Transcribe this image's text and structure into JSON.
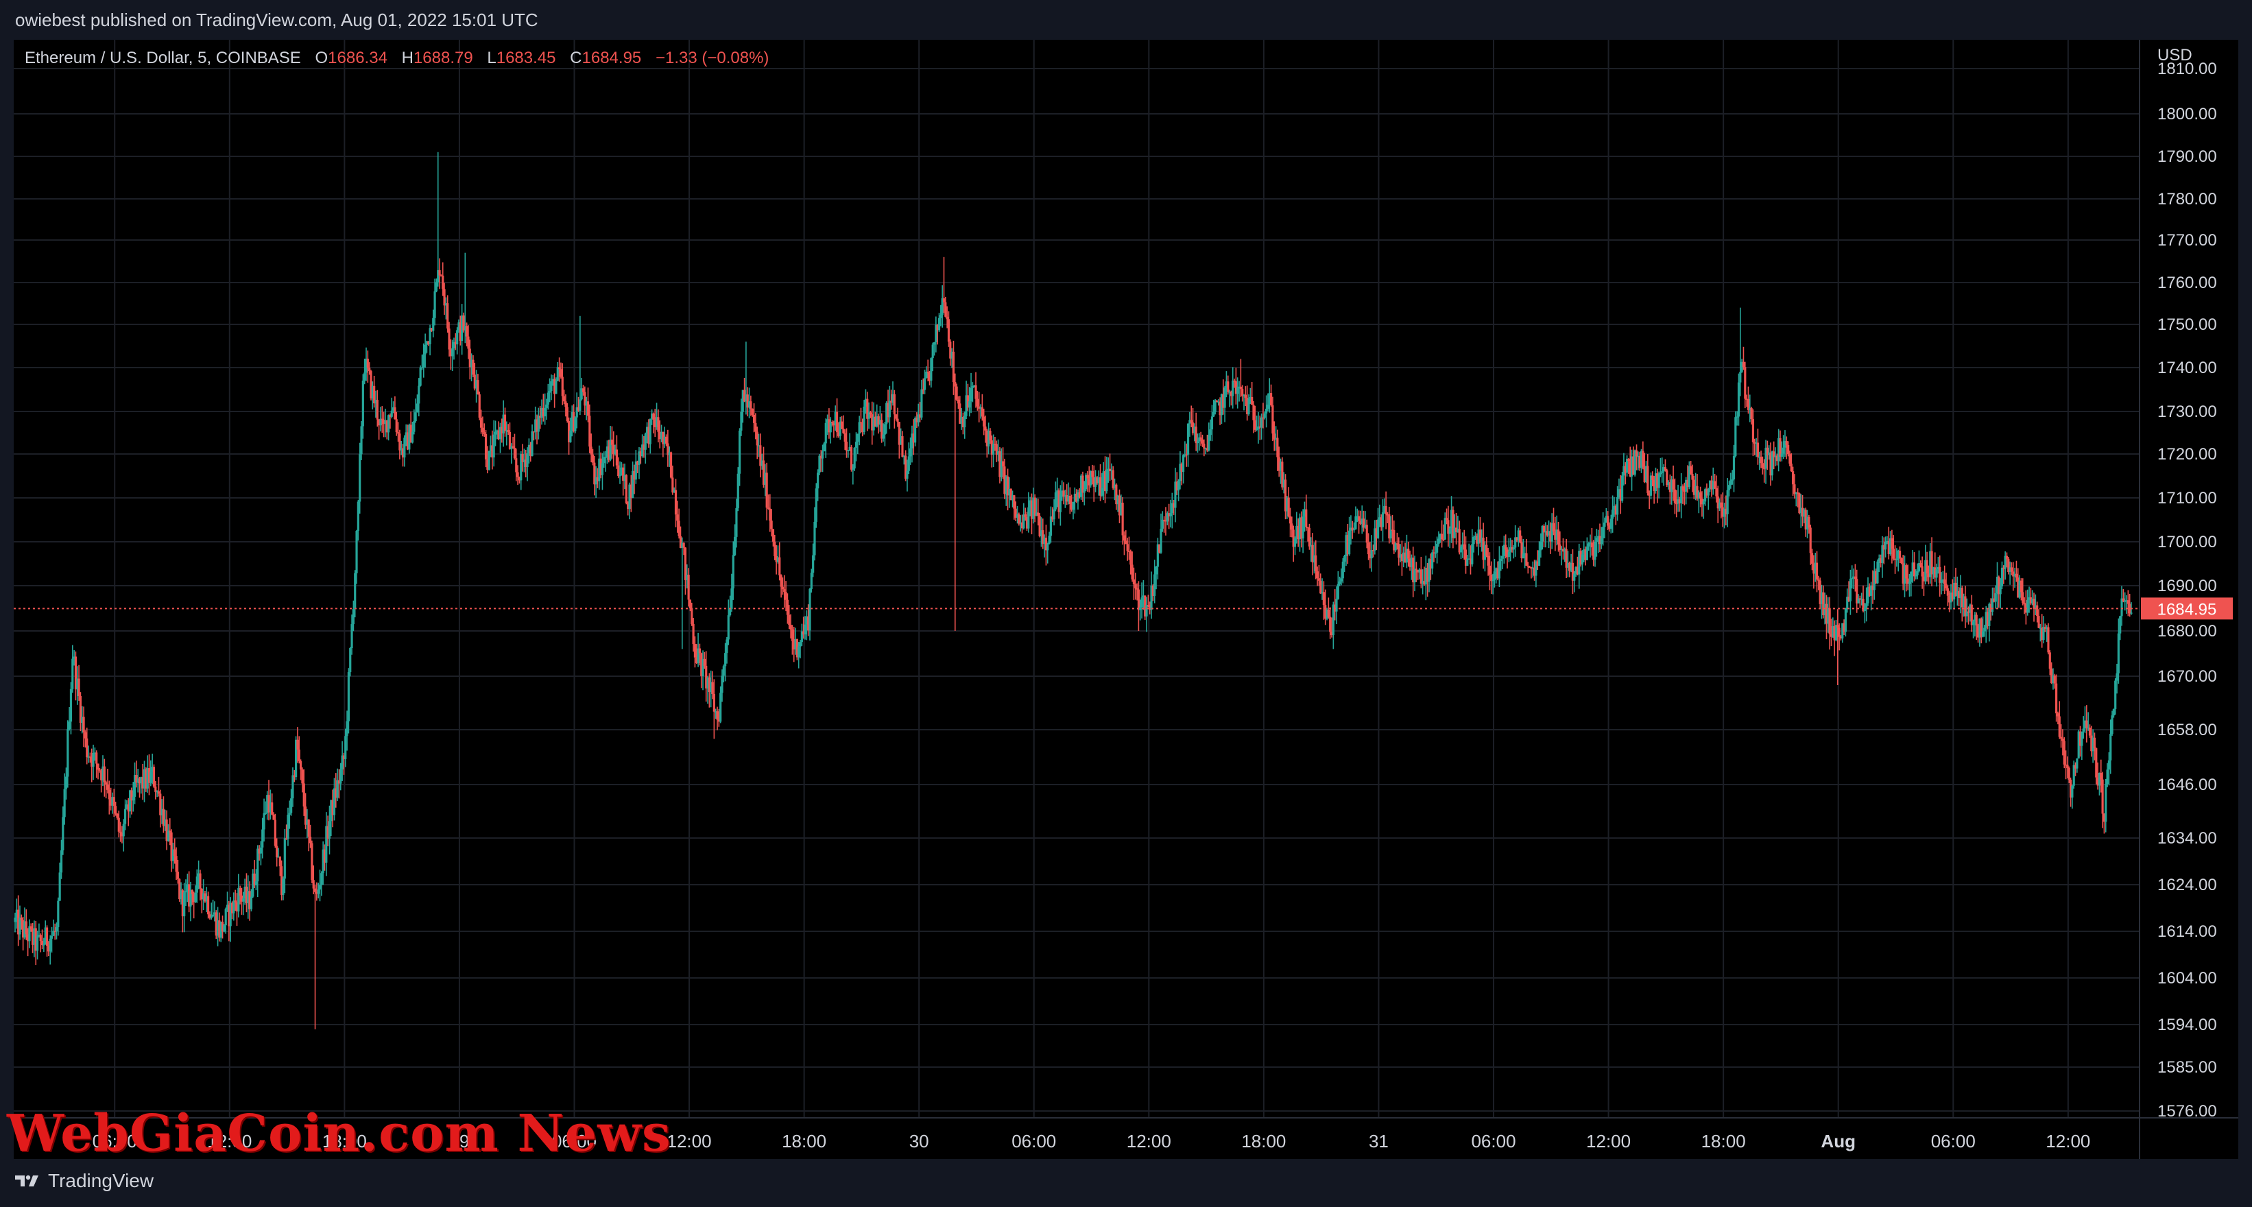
{
  "header": {
    "published_by": "owiebest published on TradingView.com, Aug 01, 2022 15:01 UTC"
  },
  "footer": {
    "brand": "TradingView",
    "logo_icon": "tradingview-logo-icon"
  },
  "watermark": "WebGiaCoin.com News",
  "legend": {
    "symbol": "Ethereum / U.S. Dollar, 5, COINBASE",
    "o_label": "O",
    "o_value": "1686.34",
    "h_label": "H",
    "h_value": "1688.79",
    "l_label": "L",
    "l_value": "1683.45",
    "c_label": "C",
    "c_value": "1684.95",
    "change": "−1.33 (−0.08%)"
  },
  "colors": {
    "background": "#000000",
    "up": "#26a69a",
    "down": "#ef5350",
    "grid": "#1c1f26",
    "price_label_bg": "#ef5350"
  },
  "chart_data": {
    "type": "candlestick",
    "currency": "USD",
    "current_price": 1684.95,
    "current_price_label": "1684.95",
    "y_ticks": [
      {
        "label": "1810.00",
        "value": 1810
      },
      {
        "label": "1800.00",
        "value": 1800
      },
      {
        "label": "1790.00",
        "value": 1790
      },
      {
        "label": "1780.00",
        "value": 1780
      },
      {
        "label": "1770.00",
        "value": 1770
      },
      {
        "label": "1760.00",
        "value": 1760
      },
      {
        "label": "1750.00",
        "value": 1750
      },
      {
        "label": "1740.00",
        "value": 1740
      },
      {
        "label": "1730.00",
        "value": 1730
      },
      {
        "label": "1720.00",
        "value": 1720
      },
      {
        "label": "1710.00",
        "value": 1710
      },
      {
        "label": "1700.00",
        "value": 1700
      },
      {
        "label": "1690.00",
        "value": 1690
      },
      {
        "label": "1680.00",
        "value": 1680
      },
      {
        "label": "1670.00",
        "value": 1670
      },
      {
        "label": "1658.00",
        "value": 1658
      },
      {
        "label": "1646.00",
        "value": 1646
      },
      {
        "label": "1634.00",
        "value": 1634
      },
      {
        "label": "1624.00",
        "value": 1624
      },
      {
        "label": "1614.00",
        "value": 1614
      },
      {
        "label": "1604.00",
        "value": 1604
      },
      {
        "label": "1594.00",
        "value": 1594
      },
      {
        "label": "1585.00",
        "value": 1585
      },
      {
        "label": "1576.00",
        "value": 1576
      }
    ],
    "x_ticks": [
      {
        "label": "06:00",
        "hour": 6
      },
      {
        "label": "12:00",
        "hour": 12
      },
      {
        "label": "18:00",
        "hour": 18
      },
      {
        "label": "29",
        "hour": 24,
        "bold": false
      },
      {
        "label": "06:00",
        "hour": 30
      },
      {
        "label": "12:00",
        "hour": 36
      },
      {
        "label": "18:00",
        "hour": 42
      },
      {
        "label": "30",
        "hour": 48,
        "bold": false
      },
      {
        "label": "06:00",
        "hour": 54
      },
      {
        "label": "12:00",
        "hour": 60
      },
      {
        "label": "18:00",
        "hour": 66
      },
      {
        "label": "31",
        "hour": 72,
        "bold": false
      },
      {
        "label": "06:00",
        "hour": 78
      },
      {
        "label": "12:00",
        "hour": 84
      },
      {
        "label": "18:00",
        "hour": 90
      },
      {
        "label": "Aug",
        "hour": 96,
        "bold": true
      },
      {
        "label": "06:00",
        "hour": 102
      },
      {
        "label": "12:00",
        "hour": 108
      }
    ],
    "x_range_hours": [
      0.8,
      111.3
    ],
    "y_range": [
      1573,
      1810
    ],
    "price_path": [
      [
        0.8,
        1616
      ],
      [
        2.0,
        1611
      ],
      [
        3.0,
        1614
      ],
      [
        3.8,
        1675
      ],
      [
        4.5,
        1654
      ],
      [
        5.5,
        1648
      ],
      [
        6.3,
        1634
      ],
      [
        7.0,
        1645
      ],
      [
        8.0,
        1648
      ],
      [
        8.5,
        1640
      ],
      [
        9.5,
        1620
      ],
      [
        10.5,
        1624
      ],
      [
        11.5,
        1614
      ],
      [
        12.5,
        1622
      ],
      [
        13.0,
        1620
      ],
      [
        13.5,
        1630
      ],
      [
        14.0,
        1644
      ],
      [
        14.7,
        1624
      ],
      [
        15.5,
        1655
      ],
      [
        16.5,
        1620
      ],
      [
        17.3,
        1640
      ],
      [
        18.0,
        1652
      ],
      [
        18.7,
        1705
      ],
      [
        19.0,
        1742
      ],
      [
        20.0,
        1725
      ],
      [
        20.5,
        1732
      ],
      [
        21.0,
        1720
      ],
      [
        21.7,
        1728
      ],
      [
        22.0,
        1740
      ],
      [
        22.5,
        1750
      ],
      [
        23.0,
        1765
      ],
      [
        23.5,
        1745
      ],
      [
        24.2,
        1750
      ],
      [
        24.8,
        1738
      ],
      [
        25.5,
        1718
      ],
      [
        26.3,
        1728
      ],
      [
        27.0,
        1715
      ],
      [
        27.7,
        1722
      ],
      [
        28.5,
        1733
      ],
      [
        29.2,
        1738
      ],
      [
        29.7,
        1725
      ],
      [
        30.5,
        1735
      ],
      [
        31.0,
        1715
      ],
      [
        32.0,
        1722
      ],
      [
        32.8,
        1710
      ],
      [
        33.5,
        1722
      ],
      [
        34.2,
        1728
      ],
      [
        35.0,
        1718
      ],
      [
        35.6,
        1700
      ],
      [
        36.3,
        1676
      ],
      [
        37.0,
        1668
      ],
      [
        37.5,
        1660
      ],
      [
        38.2,
        1690
      ],
      [
        38.8,
        1735
      ],
      [
        39.3,
        1728
      ],
      [
        40.0,
        1712
      ],
      [
        40.8,
        1690
      ],
      [
        41.5,
        1676
      ],
      [
        42.2,
        1682
      ],
      [
        42.8,
        1720
      ],
      [
        43.5,
        1730
      ],
      [
        44.5,
        1718
      ],
      [
        45.2,
        1730
      ],
      [
        46.0,
        1725
      ],
      [
        46.6,
        1735
      ],
      [
        47.3,
        1715
      ],
      [
        48.0,
        1730
      ],
      [
        48.6,
        1740
      ],
      [
        49.3,
        1758
      ],
      [
        49.8,
        1738
      ],
      [
        50.2,
        1728
      ],
      [
        50.8,
        1735
      ],
      [
        51.5,
        1725
      ],
      [
        52.0,
        1720
      ],
      [
        52.6,
        1712
      ],
      [
        53.3,
        1703
      ],
      [
        54.0,
        1708
      ],
      [
        54.6,
        1700
      ],
      [
        55.2,
        1710
      ],
      [
        56.0,
        1708
      ],
      [
        56.8,
        1716
      ],
      [
        57.3,
        1712
      ],
      [
        58.0,
        1716
      ],
      [
        58.6,
        1705
      ],
      [
        59.3,
        1688
      ],
      [
        60.0,
        1685
      ],
      [
        60.8,
        1706
      ],
      [
        61.5,
        1712
      ],
      [
        62.2,
        1728
      ],
      [
        62.8,
        1720
      ],
      [
        63.5,
        1730
      ],
      [
        64.3,
        1736
      ],
      [
        65.0,
        1733
      ],
      [
        65.6,
        1728
      ],
      [
        66.3,
        1732
      ],
      [
        66.9,
        1715
      ],
      [
        67.5,
        1700
      ],
      [
        68.2,
        1705
      ],
      [
        68.8,
        1690
      ],
      [
        69.5,
        1680
      ],
      [
        70.2,
        1698
      ],
      [
        71.0,
        1705
      ],
      [
        71.6,
        1698
      ],
      [
        72.3,
        1706
      ],
      [
        73.0,
        1698
      ],
      [
        73.6,
        1695
      ],
      [
        74.3,
        1690
      ],
      [
        75.0,
        1700
      ],
      [
        75.8,
        1705
      ],
      [
        76.5,
        1695
      ],
      [
        77.2,
        1700
      ],
      [
        78.0,
        1692
      ],
      [
        78.7,
        1698
      ],
      [
        79.4,
        1700
      ],
      [
        80.0,
        1692
      ],
      [
        80.7,
        1704
      ],
      [
        81.4,
        1700
      ],
      [
        82.1,
        1693
      ],
      [
        82.8,
        1697
      ],
      [
        83.5,
        1700
      ],
      [
        84.2,
        1706
      ],
      [
        84.9,
        1716
      ],
      [
        85.6,
        1720
      ],
      [
        86.2,
        1712
      ],
      [
        86.8,
        1716
      ],
      [
        87.5,
        1710
      ],
      [
        88.2,
        1715
      ],
      [
        88.8,
        1710
      ],
      [
        89.4,
        1714
      ],
      [
        90.1,
        1706
      ],
      [
        90.5,
        1718
      ],
      [
        90.9,
        1742
      ],
      [
        91.4,
        1728
      ],
      [
        91.9,
        1720
      ],
      [
        92.5,
        1718
      ],
      [
        93.1,
        1723
      ],
      [
        93.7,
        1712
      ],
      [
        94.3,
        1705
      ],
      [
        94.9,
        1690
      ],
      [
        95.5,
        1682
      ],
      [
        96.1,
        1678
      ],
      [
        96.7,
        1690
      ],
      [
        97.4,
        1685
      ],
      [
        98.1,
        1695
      ],
      [
        98.7,
        1700
      ],
      [
        99.4,
        1693
      ],
      [
        100.1,
        1692
      ],
      [
        100.8,
        1695
      ],
      [
        101.5,
        1690
      ],
      [
        102.2,
        1688
      ],
      [
        102.9,
        1683
      ],
      [
        103.6,
        1680
      ],
      [
        104.3,
        1690
      ],
      [
        104.9,
        1696
      ],
      [
        105.5,
        1688
      ],
      [
        106.2,
        1685
      ],
      [
        106.9,
        1678
      ],
      [
        107.5,
        1660
      ],
      [
        108.1,
        1645
      ],
      [
        108.8,
        1660
      ],
      [
        109.4,
        1652
      ],
      [
        109.9,
        1640
      ],
      [
        110.4,
        1665
      ],
      [
        110.8,
        1686
      ],
      [
        111.3,
        1685
      ]
    ],
    "spikes": [
      [
        3.8,
        1675
      ],
      [
        16.5,
        1593
      ],
      [
        22.9,
        1791
      ],
      [
        24.3,
        1767
      ],
      [
        30.3,
        1752
      ],
      [
        35.6,
        1676
      ],
      [
        37.3,
        1656
      ],
      [
        39.0,
        1746
      ],
      [
        49.3,
        1766
      ],
      [
        49.9,
        1680
      ],
      [
        59.5,
        1680
      ],
      [
        64.8,
        1742
      ],
      [
        69.6,
        1676
      ],
      [
        90.9,
        1754
      ],
      [
        96.0,
        1668
      ],
      [
        108.1,
        1641
      ],
      [
        109.9,
        1635
      ]
    ]
  }
}
